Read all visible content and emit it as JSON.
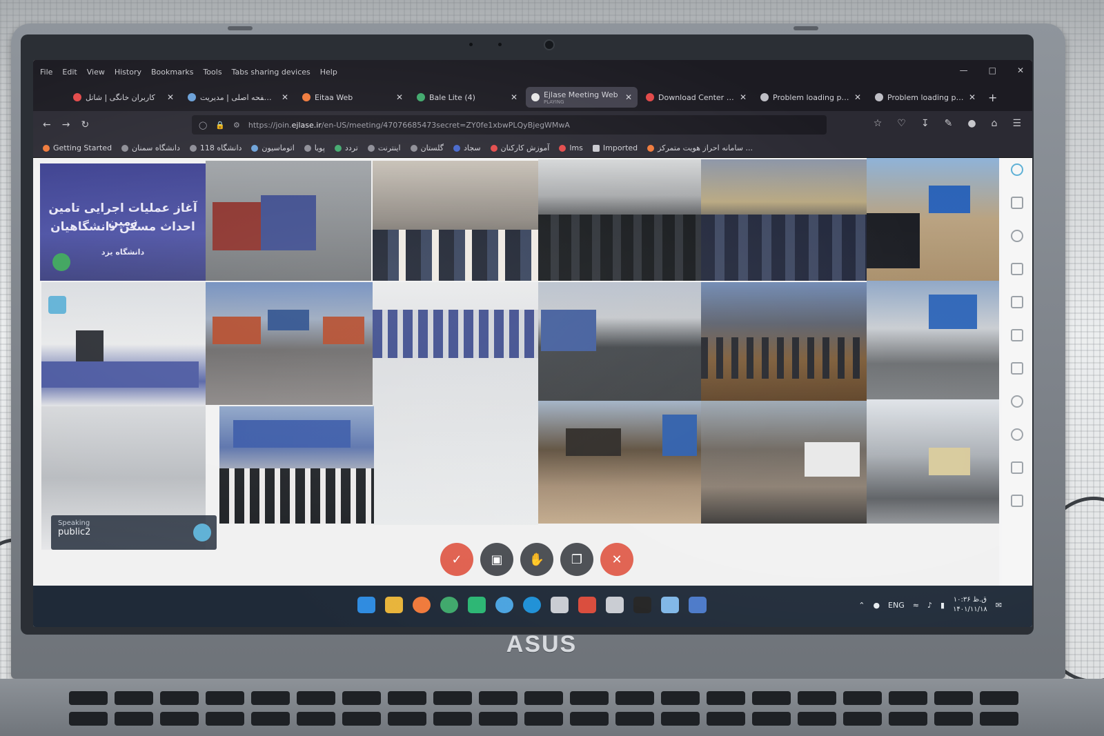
{
  "browser": {
    "menu": [
      "File",
      "Edit",
      "View",
      "History",
      "Bookmarks",
      "Tools",
      "Tabs sharing devices",
      "Help"
    ],
    "tabs": [
      {
        "title": "کاربران خانگی | شاتل",
        "active": false,
        "color": "#e34a4a"
      },
      {
        "title": "صفحه اصلی | مدیریت ...",
        "active": false,
        "color": "#6aa0d8"
      },
      {
        "title": "Eitaa Web",
        "active": false,
        "color": "#f07a3b"
      },
      {
        "title": "Bale Lite (4)",
        "active": false,
        "color": "#3fa86b"
      },
      {
        "title": "Ejlase Meeting Web",
        "subtitle": "PLAYING",
        "active": true,
        "color": "#e7e7e7"
      },
      {
        "title": "Download Center | A",
        "active": false,
        "color": "#e24848"
      },
      {
        "title": "Problem loading page",
        "active": false,
        "color": "#bfbfc6"
      },
      {
        "title": "Problem loading page",
        "active": false,
        "color": "#bfbfc6"
      }
    ],
    "new_tab": "+",
    "url": {
      "prefix": "https://join.",
      "domain": "ejlase.ir",
      "rest": "/en-US/meeting/47076685473secret=ZY0fe1xbwPLQyBjegWMwA"
    },
    "bookmarks": [
      {
        "label": "Getting Started",
        "color": "#f07a3b"
      },
      {
        "label": "دانشگاه سمنان",
        "color": "#8c8c95"
      },
      {
        "label": "دانشگاه 118",
        "color": "#8c8c95"
      },
      {
        "label": "اتوماسیون",
        "color": "#6aa0d8"
      },
      {
        "label": "پویا",
        "color": "#8c8c95"
      },
      {
        "label": "تردد",
        "color": "#3fa86b"
      },
      {
        "label": "اینترنت",
        "color": "#8c8c95"
      },
      {
        "label": "گلستان",
        "color": "#8c8c95"
      },
      {
        "label": "سجاد",
        "color": "#4466cc"
      },
      {
        "label": "آموزش کارکنان",
        "color": "#e34a4a"
      },
      {
        "label": "lms",
        "color": "#e34a4a"
      },
      {
        "label": "Imported",
        "color": "#c9c9cf"
      },
      {
        "label": "سامانه احراز هویت متمرکز ...",
        "color": "#f07a3b"
      }
    ]
  },
  "meeting": {
    "banner_line1": "آغاز عملیات اجرایی تامین زمین",
    "banner_line2": "احداث مسکن دانشگاهیان",
    "banner_line3": "دانشگاه یزد",
    "speaking_label": "Speaking",
    "speaking_name": "public2",
    "controls": [
      "mic-off",
      "camera",
      "raise-hand",
      "share-screen",
      "leave"
    ]
  },
  "taskbar": {
    "lang": "ENG",
    "time": "۱۰:۳۶ ق.ظ",
    "date": "۱۴۰۱/۱۱/۱۸"
  },
  "device": {
    "brand": "ASUS"
  }
}
